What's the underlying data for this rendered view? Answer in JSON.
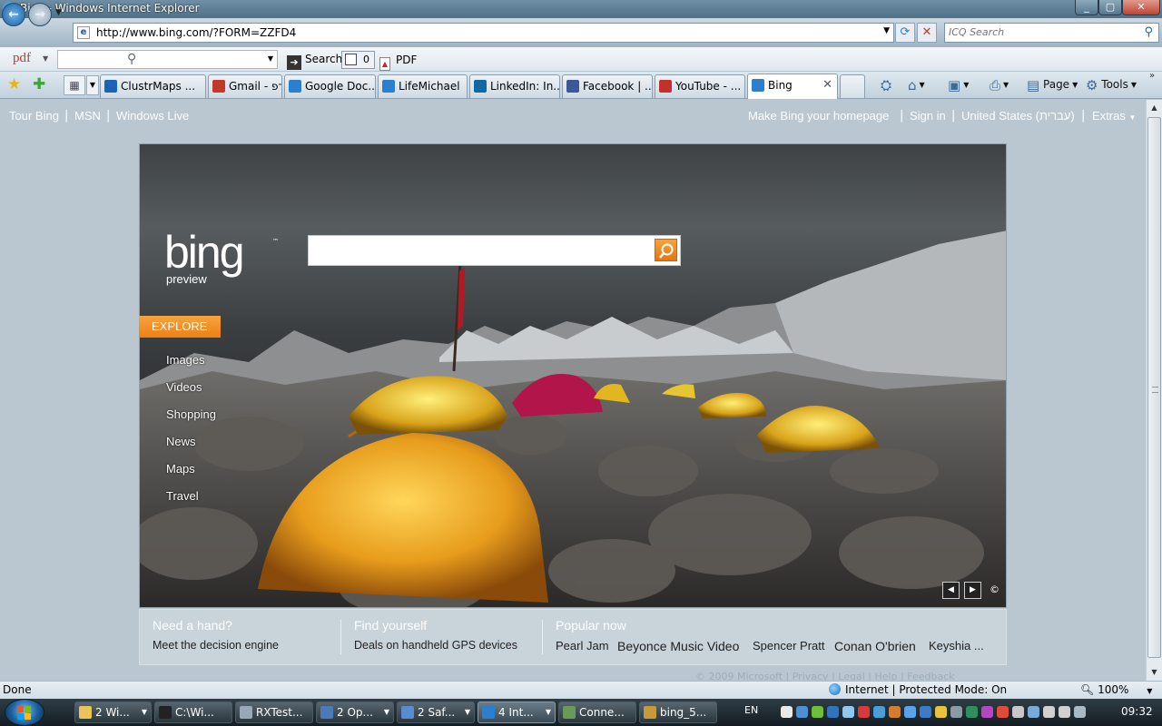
{
  "window": {
    "title": "Bing - Windows Internet Explorer",
    "min": "_",
    "max": "▢",
    "close": "✕"
  },
  "nav": {
    "url": "http://www.bing.com/?FORM=ZZFD4",
    "icq_placeholder": "ICQ Search"
  },
  "pdfbar": {
    "logo": "pdf",
    "search_label": "Search",
    "count": "0",
    "pdf_label": "PDF"
  },
  "tabs": [
    {
      "label": "ClustrMaps ...",
      "icon": "clustrmaps-icon",
      "color": "#1b63b5"
    },
    {
      "label": "Gmail - הדפ...",
      "icon": "gmail-icon",
      "color": "#c4382a"
    },
    {
      "label": "Google Doc...",
      "icon": "ie-page-icon",
      "color": "#2a7fd0"
    },
    {
      "label": "LifeMichael",
      "icon": "ie-page-icon",
      "color": "#2a7fd0"
    },
    {
      "label": "LinkedIn: In...",
      "icon": "linkedin-icon",
      "color": "#0f6aa3"
    },
    {
      "label": "Facebook | ...",
      "icon": "facebook-icon",
      "color": "#3b5998"
    },
    {
      "label": "YouTube - ...",
      "icon": "youtube-icon",
      "color": "#c4302b"
    },
    {
      "label": "Bing",
      "icon": "ie-page-icon",
      "color": "#2a7fd0",
      "active": true
    }
  ],
  "commands": {
    "page": "Page",
    "tools": "Tools"
  },
  "bing": {
    "toplinks_left": [
      "Tour Bing",
      "MSN",
      "Windows Live"
    ],
    "toplinks_right": [
      "Make Bing your homepage",
      "Sign in",
      "United States (עברית)",
      "Extras"
    ],
    "logo": "bing",
    "tm": "™",
    "preview": "preview",
    "search_value": "",
    "explore": "EXPLORE",
    "nav": [
      "Images",
      "Videos",
      "Shopping",
      "News",
      "Maps",
      "Travel"
    ],
    "bottom": {
      "need_hand_title": "Need a hand?",
      "need_hand_sub": "Meet the decision engine",
      "find_title": "Find yourself",
      "find_sub": "Deals on handheld GPS devices",
      "popular_title": "Popular now",
      "popular": [
        "Pearl Jam",
        "Beyonce Music Video",
        "Spencer Pratt",
        "Conan O'brien",
        "Keyshia ..."
      ]
    },
    "footer": "© 2009 Microsoft | Privacy | Legal | Help | Feedback"
  },
  "status": {
    "text": "Done",
    "zone": "Internet | Protected Mode: On",
    "zoom": "100%"
  },
  "taskbar": {
    "items": [
      {
        "label": "2 Wi...",
        "color": "#e8c45a",
        "dd": true
      },
      {
        "label": "C:\\Wi...",
        "color": "#222222",
        "dd": false
      },
      {
        "label": "RXTest...",
        "color": "#9aa8b5",
        "dd": false
      },
      {
        "label": "2 Op...",
        "color": "#4a7ab8",
        "dd": true
      },
      {
        "label": "2 Saf...",
        "color": "#5a8ad0",
        "dd": true
      },
      {
        "label": "4 Int...",
        "color": "#2a7fd0",
        "dd": true,
        "active": true
      },
      {
        "label": "Conne...",
        "color": "#6a9a5a",
        "dd": false
      },
      {
        "label": "bing_5...",
        "color": "#c69a3a",
        "dd": false
      }
    ],
    "lang": "EN",
    "clock": "09:32"
  }
}
